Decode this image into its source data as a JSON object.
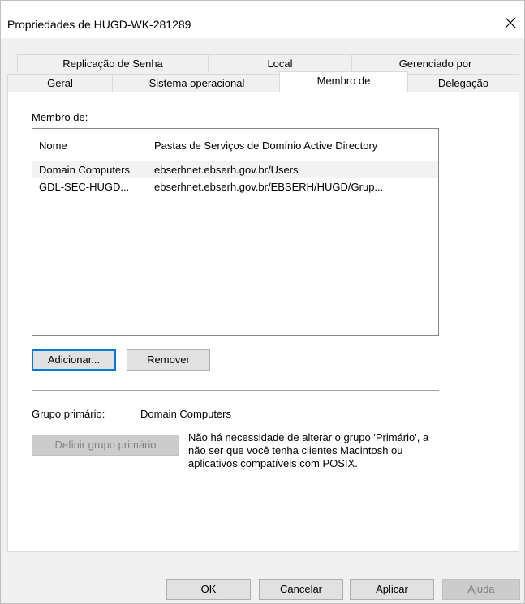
{
  "dialog": {
    "title": "Propriedades de HUGD-WK-281289"
  },
  "tabs": {
    "row1": [
      "Replicação de Senha",
      "Local",
      "Gerenciado por"
    ],
    "row2": [
      "Geral",
      "Sistema operacional",
      "Membro de",
      "Delegação"
    ],
    "selected": "Membro de"
  },
  "member_of": {
    "label": "Membro de:",
    "columns": [
      "Nome",
      "Pastas de Serviços de Domínio Active Directory"
    ],
    "rows": [
      [
        "Domain Computers",
        "ebserhnet.ebserh.gov.br/Users"
      ],
      [
        "GDL-SEC-HUGD...",
        "ebserhnet.ebserh.gov.br/EBSERH/HUGD/Grup..."
      ]
    ],
    "add_label": "Adicionar...",
    "remove_label": "Remover"
  },
  "primary_group": {
    "label": "Grupo primário:",
    "value": "Domain Computers",
    "set_label": "Definir grupo primário",
    "info": "Não há necessidade de alterar o grupo 'Primário', a não ser que você tenha clientes Macintosh ou aplicativos compatíveis com POSIX."
  },
  "footer": {
    "ok": "OK",
    "cancel": "Cancelar",
    "apply": "Aplicar",
    "help": "Ajuda"
  },
  "colors": {
    "focus_border": "#0078d7",
    "button_face": "#e1e1e1",
    "window_bg": "#f0f0f0"
  }
}
